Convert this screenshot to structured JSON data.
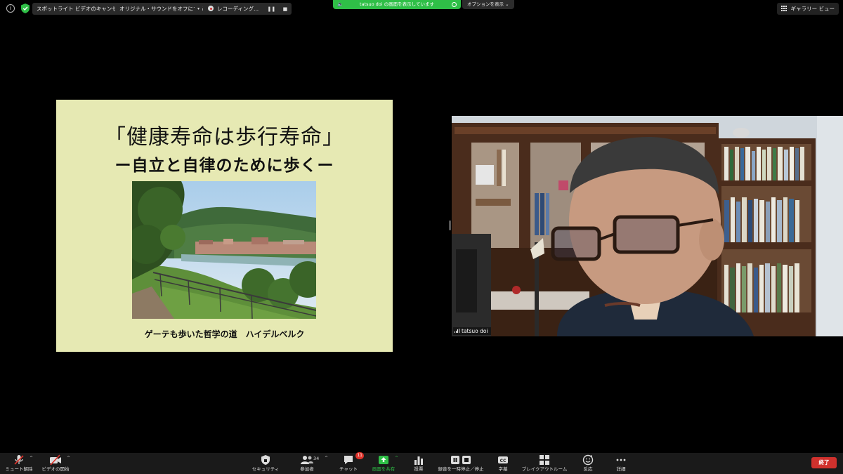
{
  "topbar": {
    "info_icon": "info-icon",
    "security_icon": "shield-check-icon",
    "spotlight_cancel": "スポットライト ビデオのキャンセル",
    "original_sound_off": "オリジナル・サウンドをオフにする",
    "recording_label": "レコーディング...",
    "share_banner": "tatsuo doi の画面を表示しています",
    "options": "オプションを表示",
    "gallery_view": "ギャラリー ビュー"
  },
  "slide": {
    "title": "「健康寿命は歩行寿命」",
    "subtitle": "ー自立と自律のために歩くー",
    "caption": "ゲーテも歩いた哲学の道　ハイデルベルク"
  },
  "video": {
    "participant_name": "tatsuo doi"
  },
  "toolbar": {
    "unmute": "ミュート解除",
    "start_video": "ビデオの開始",
    "security": "セキュリティ",
    "participants": "参加者",
    "participants_count": "34",
    "chat": "チャット",
    "chat_badge": "11",
    "share_screen": "画面を共有",
    "polls": "投票",
    "recording_pause_stop": "録音を一時停止／停止",
    "captions": "字幕",
    "breakout_rooms": "ブレイクアウトルーム",
    "reactions": "反応",
    "more": "詳細",
    "end": "終了"
  },
  "colors": {
    "share_green": "#2fbf47",
    "end_red": "#d0312d",
    "slide_bg": "#e6e9b3",
    "badge_red": "#e0332b"
  }
}
